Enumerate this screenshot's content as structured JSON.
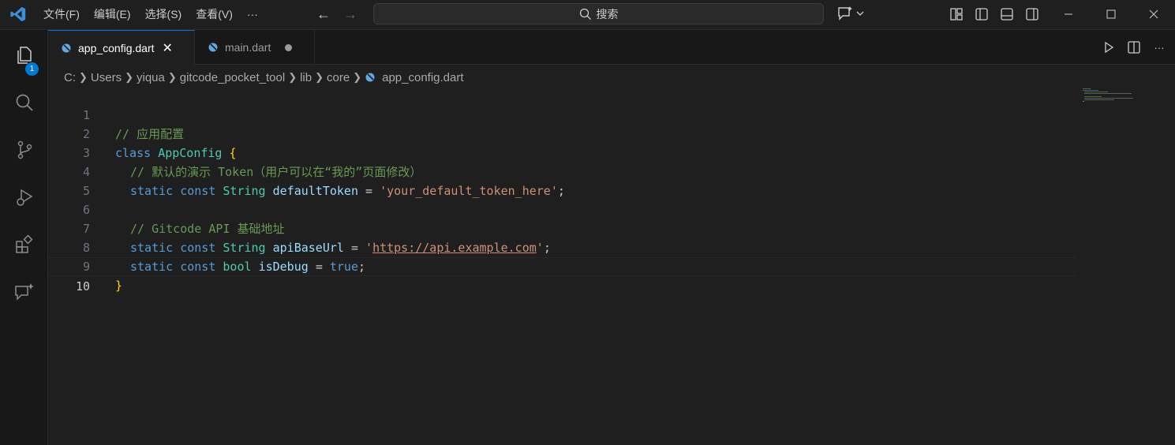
{
  "menu": {
    "file": "文件(F)",
    "edit": "编辑(E)",
    "select": "选择(S)",
    "view": "查看(V)",
    "more": "···"
  },
  "search": {
    "label": "搜索"
  },
  "activity": {
    "explorer_badge": "1"
  },
  "tabs": [
    {
      "label": "app_config.dart",
      "active": true
    },
    {
      "label": "main.dart",
      "active": false,
      "dirty": true
    }
  ],
  "breadcrumb": [
    "C:",
    "Users",
    "yiqua",
    "gitcode_pocket_tool",
    "lib",
    "core",
    "app_config.dart"
  ],
  "code": {
    "line_numbers": [
      "1",
      "2",
      "3",
      "4",
      "5",
      "6",
      "7",
      "8",
      "9",
      "10"
    ],
    "l1": "// 应用配置",
    "l2_kw": "class",
    "l2_type": "AppConfig",
    "l2_brace": "{",
    "l3": "// 默认的演示 Token（用户可以在“我的”页面修改）",
    "l4_static": "static",
    "l4_const": "const",
    "l4_type": "String",
    "l4_var": "defaultToken",
    "l4_eq": "=",
    "l4_q1": "'",
    "l4_str": "your_default_token_here",
    "l4_q2": "'",
    "l4_semi": ";",
    "l6": "// Gitcode API 基础地址",
    "l7_static": "static",
    "l7_const": "const",
    "l7_type": "String",
    "l7_var": "apiBaseUrl",
    "l7_eq": "=",
    "l7_q1": "'",
    "l7_url": "https://api.example.com",
    "l7_q2": "'",
    "l7_semi": ";",
    "l8_static": "static",
    "l8_const": "const",
    "l8_type": "bool",
    "l8_var": "isDebug",
    "l8_eq": "=",
    "l8_val": "true",
    "l8_semi": ";",
    "l9_brace": "}"
  },
  "colors": {
    "accent": "#0078d4",
    "comment": "#6a9955",
    "keyword": "#569cd6",
    "type": "#4ec9b0",
    "variable": "#9cdcfe",
    "string": "#ce9178",
    "brace": "#ffd700"
  }
}
